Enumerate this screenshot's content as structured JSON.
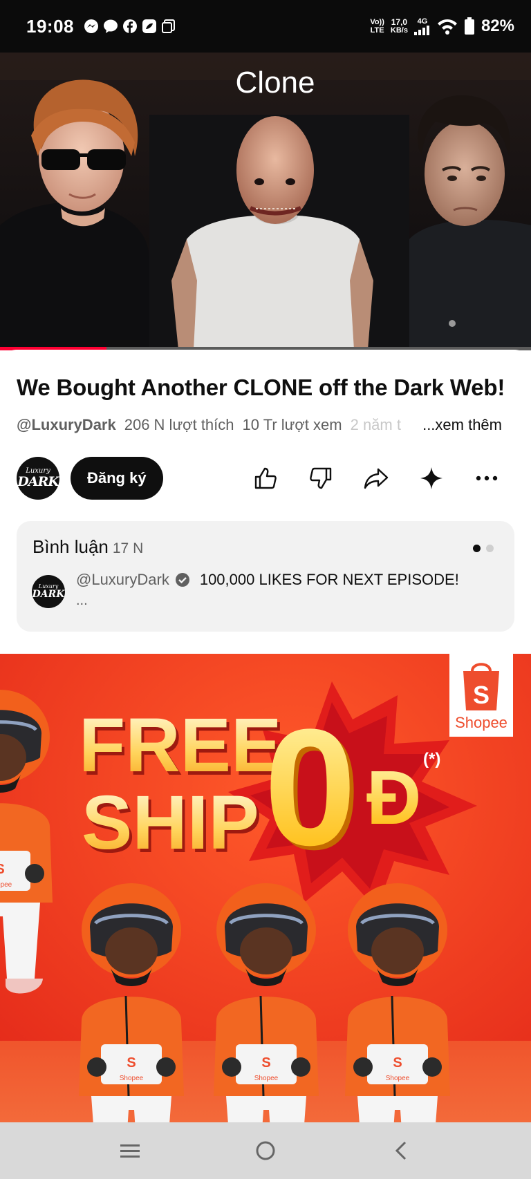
{
  "status_bar": {
    "time": "19:08",
    "notification_icons": [
      "messenger-icon",
      "chat-bubble-icon",
      "facebook-icon",
      "app-icon",
      "screen-icon"
    ],
    "volte_top": "Vo))",
    "volte_bottom": "LTE",
    "net_speed_value": "17,0",
    "net_speed_unit": "KB/s",
    "network_type": "4G",
    "battery_percent": "82%"
  },
  "video": {
    "overlay_text": "Clone",
    "progress": 0.2
  },
  "video_info": {
    "title": "We Bought Another CLONE off the Dark Web!",
    "channel_handle": "@LuxuryDark",
    "likes": "206 N lượt thích",
    "views": "10 Tr lượt xem",
    "age": "2 năm t",
    "more_label": "...xem thêm"
  },
  "channel": {
    "avatar_line1": "Luxury",
    "avatar_line2": "DARK",
    "subscribe_label": "Đăng ký"
  },
  "actions": [
    "like-icon",
    "dislike-icon",
    "share-icon",
    "sparkle-icon",
    "more-icon"
  ],
  "comments": {
    "title": "Bình luận",
    "count": "17 N",
    "author": "@LuxuryDark",
    "text": "100,000 LIKES FOR NEXT EPISODE!",
    "ellipsis": "...",
    "pager_active_color": "#0f0f0f",
    "pager_inactive_color": "#cfcfcf"
  },
  "ad": {
    "brand": "Shopee",
    "line1": "FREE",
    "line2": "SHIP",
    "price": "0Đ",
    "asterisk": "(*)",
    "box_logo": "S",
    "box_text": "Shopee",
    "bg_color": "#f2391f",
    "accent_color": "#ee4d2d"
  },
  "nav_bar": [
    "menu-icon",
    "home-icon",
    "back-icon"
  ]
}
